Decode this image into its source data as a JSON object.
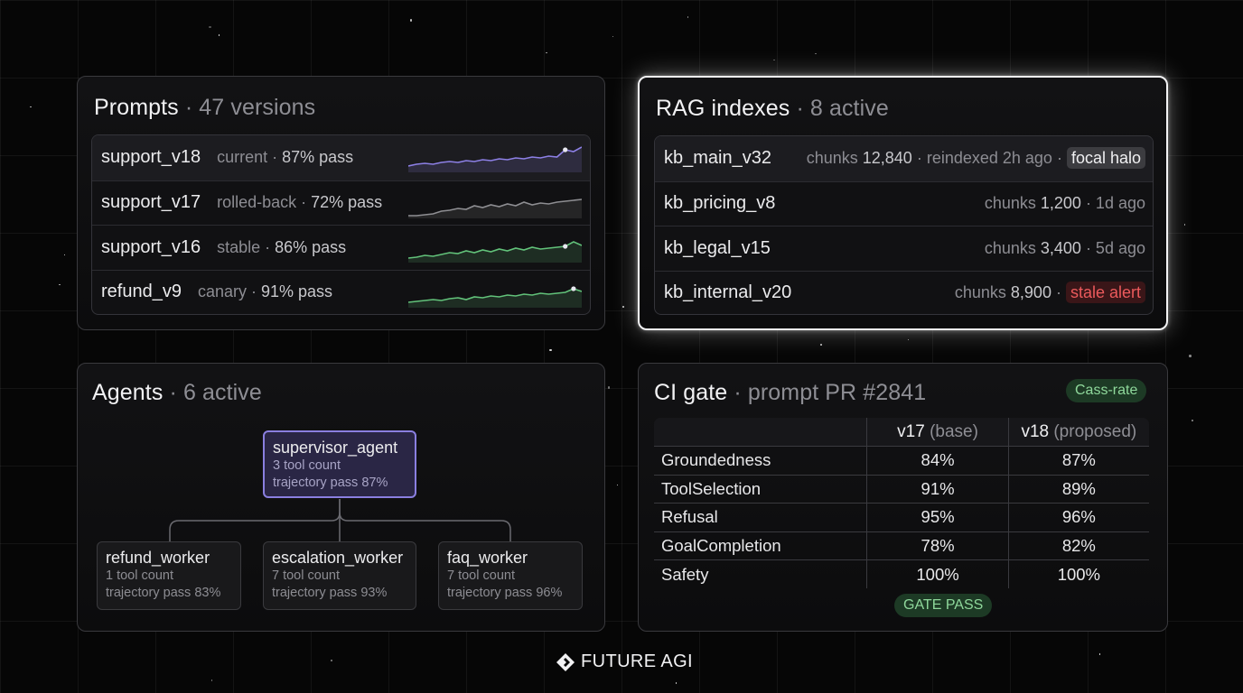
{
  "prompts": {
    "title": "Prompts",
    "subtitle": "· 47 versions",
    "rows": [
      {
        "name": "support_v18",
        "meta_prefix": "current · ",
        "meta_value": "87% pass",
        "spark_color": "#8d80e6",
        "highlighted": true
      },
      {
        "name": "support_v17",
        "meta_prefix": "rolled-back · ",
        "meta_value": "72% pass",
        "spark_color": "#8e8e92",
        "highlighted": false
      },
      {
        "name": "support_v16",
        "meta_prefix": "stable · ",
        "meta_value": "86% pass",
        "spark_color": "#62c27a",
        "highlighted": false
      },
      {
        "name": "refund_v9",
        "meta_prefix": "canary · ",
        "meta_value": "91% pass",
        "spark_color": "#62c27a",
        "highlighted": false
      }
    ]
  },
  "rag": {
    "title": "RAG indexes",
    "subtitle": "· 8 active",
    "rows": [
      {
        "name": "kb_main_v32",
        "chunks_label": "chunks ",
        "chunks": "12,840",
        "age": " · reindexed 2h ago",
        "tag_sep": " · ",
        "tag": "focal halo",
        "tag_type": "halo"
      },
      {
        "name": "kb_pricing_v8",
        "chunks_label": "chunks ",
        "chunks": "1,200",
        "age": " · 1d ago",
        "tag_sep": "",
        "tag": "",
        "tag_type": ""
      },
      {
        "name": "kb_legal_v15",
        "chunks_label": "chunks ",
        "chunks": "3,400",
        "age": " · 5d ago",
        "tag_sep": "",
        "tag": "",
        "tag_type": ""
      },
      {
        "name": "kb_internal_v20",
        "chunks_label": "chunks ",
        "chunks": "8,900",
        "age": "",
        "tag_sep": " · ",
        "tag": "stale alert",
        "tag_type": "stale"
      }
    ]
  },
  "agents": {
    "title": "Agents",
    "subtitle": "· 6 active",
    "supervisor": {
      "name": "supervisor_agent",
      "tools": "3 tool count",
      "trajectory": "trajectory pass 87%"
    },
    "workers": [
      {
        "name": "refund_worker",
        "tools": "1 tool count",
        "trajectory": "trajectory pass 83%"
      },
      {
        "name": "escalation_worker",
        "tools": "7 tool count",
        "trajectory": "trajectory pass 93%"
      },
      {
        "name": "faq_worker",
        "tools": "7 tool count",
        "trajectory": "trajectory pass 96%"
      }
    ]
  },
  "ci": {
    "title": "CI gate",
    "subtitle": "· prompt PR #2841",
    "badge": "Cass-rate",
    "col_base": "v17",
    "col_base_note": " (base)",
    "col_new": "v18",
    "col_new_note": " (proposed)",
    "rows": [
      {
        "metric": "Groundedness",
        "base": "84%",
        "proposed": "87%"
      },
      {
        "metric": "ToolSelection",
        "base": "91%",
        "proposed": "89%"
      },
      {
        "metric": "Refusal",
        "base": "95%",
        "proposed": "96%"
      },
      {
        "metric": "GoalCompletion",
        "base": "78%",
        "proposed": "82%"
      },
      {
        "metric": "Safety",
        "base": "100%",
        "proposed": "100%"
      }
    ],
    "gate": "GATE PASS"
  },
  "brand": {
    "name": "FUTURE AGI",
    "icon": "diamond-logo-icon"
  },
  "colors": {
    "accent_purple": "#8a7fe0",
    "pass_green": "#8fd89b",
    "alert_red": "#ec5a5c"
  }
}
